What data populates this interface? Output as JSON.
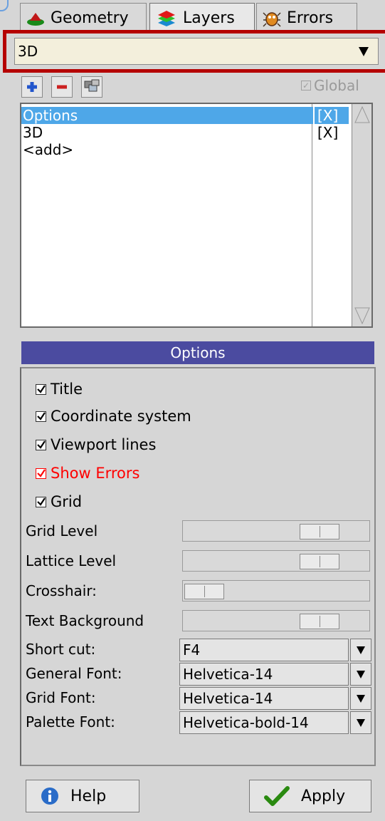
{
  "tabs": [
    {
      "label": "Geometry",
      "icon": "geometry-icon",
      "active": false
    },
    {
      "label": "Layers",
      "icon": "layers-icon",
      "active": true
    },
    {
      "label": "Errors",
      "icon": "errors-icon",
      "active": false
    }
  ],
  "layer_select": {
    "value": "3D"
  },
  "toolbar": {
    "global_label": "Global",
    "global_checked": true
  },
  "layers": {
    "rows": [
      {
        "name": "Options",
        "flag": "[X]",
        "selected": true
      },
      {
        "name": "3D",
        "flag": "[X]",
        "selected": false
      },
      {
        "name": "<add>",
        "flag": "",
        "selected": false
      }
    ]
  },
  "options": {
    "title": "Options",
    "checkboxes": [
      {
        "label": "Title",
        "checked": true,
        "color": "#000000"
      },
      {
        "label": "Coordinate system",
        "checked": true,
        "color": "#000000"
      },
      {
        "label": "Viewport lines",
        "checked": true,
        "color": "#000000"
      },
      {
        "label": "Show Errors",
        "checked": true,
        "color": "#ff0000"
      },
      {
        "label": "Grid",
        "checked": true,
        "color": "#000000"
      }
    ],
    "sliders": [
      {
        "label": "Grid Level",
        "level": 0.8
      },
      {
        "label": "Lattice Level",
        "level": 0.8
      },
      {
        "label": "Crosshair:",
        "level": 0.0
      },
      {
        "label": "Text Background",
        "level": 0.8
      }
    ],
    "choices": [
      {
        "label": "Short cut:",
        "value": "F4"
      },
      {
        "label": "General Font:",
        "value": "Helvetica-14"
      },
      {
        "label": "Grid Font:",
        "value": "Helvetica-14"
      },
      {
        "label": "Palette Font:",
        "value": "Helvetica-bold-14"
      }
    ]
  },
  "buttons": {
    "help": "Help",
    "apply": "Apply"
  },
  "colors": {
    "selection": "#4ea7e8",
    "header": "#4b4ba0",
    "highlight_frame": "#b50000"
  }
}
